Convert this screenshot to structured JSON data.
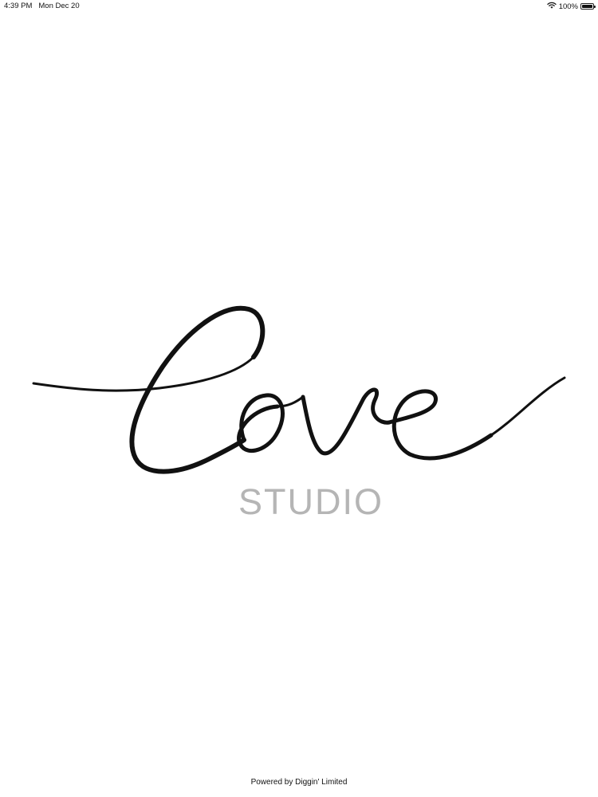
{
  "status_bar": {
    "time": "4:39 PM",
    "date": "Mon Dec 20",
    "battery_text": "100%",
    "battery_level": 1.0,
    "wifi_icon": "wifi-icon",
    "battery_icon": "battery-icon"
  },
  "logo": {
    "script_text": "Love",
    "subtitle": "STUDIO",
    "script_color": "#111111",
    "subtitle_color": "#b5b5b5"
  },
  "footer": {
    "text": "Powered by Diggin' Limited"
  }
}
